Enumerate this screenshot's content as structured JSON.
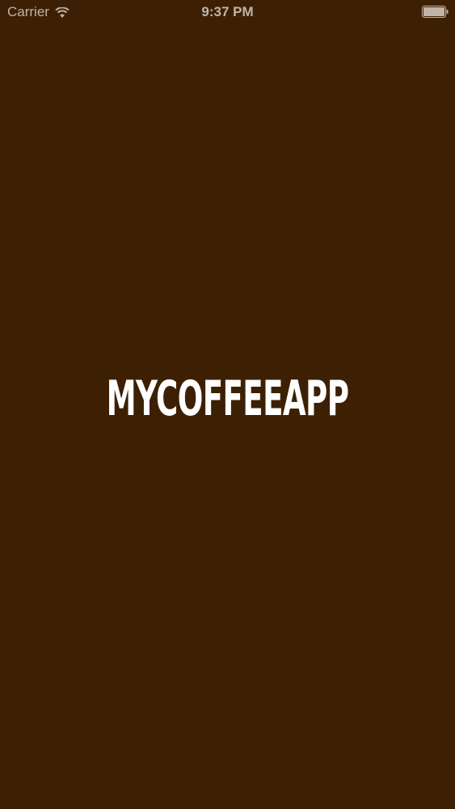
{
  "status_bar": {
    "carrier": "Carrier",
    "time": "9:37 PM",
    "wifi_icon": "wifi-icon",
    "battery_icon": "battery-icon",
    "text_color": "#bfb4a8"
  },
  "splash": {
    "logo_text": "MYCOFFEEAPP",
    "background_color": "#3d2004",
    "logo_color": "#ffffff"
  }
}
